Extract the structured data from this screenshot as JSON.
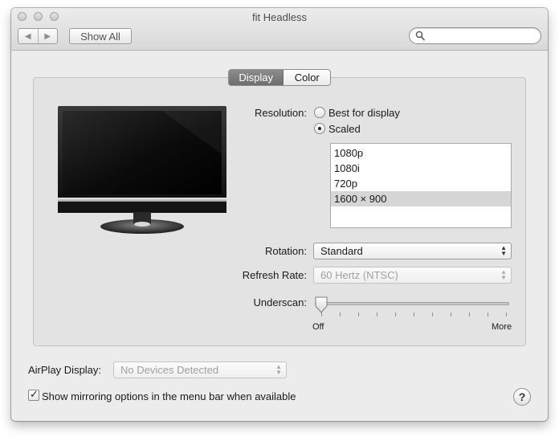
{
  "window": {
    "title": "fit Headless"
  },
  "toolbar": {
    "back_icon": "back-arrow-icon",
    "forward_icon": "forward-arrow-icon",
    "show_all_label": "Show All",
    "search": {
      "value": "",
      "placeholder": ""
    }
  },
  "tabs": [
    {
      "label": "Display",
      "selected": true
    },
    {
      "label": "Color",
      "selected": false
    }
  ],
  "resolution": {
    "label": "Resolution:",
    "options": [
      {
        "label": "Best for display",
        "selected": false
      },
      {
        "label": "Scaled",
        "selected": true
      }
    ],
    "modes": [
      {
        "label": "1080p",
        "selected": false
      },
      {
        "label": "1080i",
        "selected": false
      },
      {
        "label": "720p",
        "selected": false
      },
      {
        "label": "1600 × 900",
        "selected": true
      }
    ]
  },
  "rotation": {
    "label": "Rotation:",
    "value": "Standard"
  },
  "refresh_rate": {
    "label": "Refresh Rate:",
    "value": "60 Hertz (NTSC)",
    "enabled": false
  },
  "underscan": {
    "label": "Underscan:",
    "min_label": "Off",
    "max_label": "More",
    "value": 0
  },
  "airplay": {
    "label": "AirPlay Display:",
    "value": "No Devices Detected",
    "enabled": false
  },
  "mirroring": {
    "label": "Show mirroring options in the menu bar when available",
    "checked": true
  },
  "help": {
    "label": "?"
  }
}
